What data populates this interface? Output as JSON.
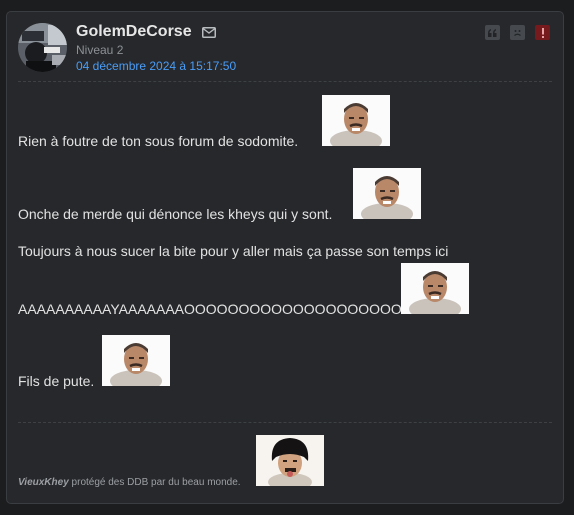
{
  "post": {
    "author": "GolemDeCorse",
    "level": "Niveau 2",
    "date": "04 décembre 2024 à 15:17:50",
    "icons": {
      "mail": "envelope-icon",
      "quote": "quote-icon",
      "ignore": "sad-face-icon",
      "report": "exclamation-icon"
    },
    "lines": [
      "Rien à foutre de ton sous forum de sodomite.",
      "Onche de merde qui dénonce les kheys qui y sont.",
      "Toujours à nous sucer la bite pour y aller mais ça passe son temps ici",
      "AAAAAAAAAAYAAAAAAAOOOOOOOOOOOOOOOOOOOO",
      "Fils de pute."
    ],
    "stickers": [
      "risitas-sticker",
      "risitas-sticker",
      "risitas-sticker",
      "risitas-sticker",
      "risitas-sticker",
      "bowl-cut-sticker"
    ]
  },
  "signature": {
    "author": "VieuxKhey",
    "text": "protégé des DDB par du beau monde."
  }
}
